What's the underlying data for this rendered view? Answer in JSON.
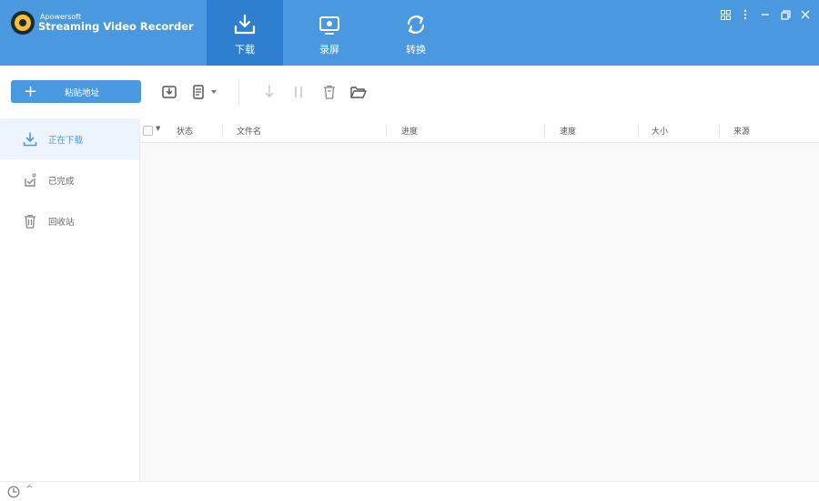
{
  "app": {
    "brand_small": "Apowersoft",
    "brand_name": "Streaming Video Recorder"
  },
  "tabs": [
    {
      "label": "下载",
      "active": true
    },
    {
      "label": "录屏",
      "active": false
    },
    {
      "label": "转换",
      "active": false
    }
  ],
  "window_controls": [
    "grid-icon",
    "more-icon",
    "minimize-icon",
    "restore-icon",
    "close-icon"
  ],
  "toolbar": {
    "paste_label": "粘贴地址",
    "icons": [
      "download-add-icon",
      "batch-download-icon",
      "start-icon",
      "pause-icon",
      "delete-icon",
      "open-folder-icon"
    ]
  },
  "sidebar": {
    "items": [
      {
        "label": "正在下载",
        "icon": "download-icon",
        "active": true
      },
      {
        "label": "已完成",
        "icon": "completed-icon",
        "active": false
      },
      {
        "label": "回收站",
        "icon": "trash-icon",
        "active": false
      }
    ]
  },
  "table": {
    "columns": [
      "状态",
      "文件名",
      "进度",
      "速度",
      "大小",
      "来源"
    ],
    "rows": []
  },
  "colors": {
    "accent": "#4a98df",
    "accent_dark": "#2f7fd0",
    "sidebar_active_bg": "#edf4fd"
  }
}
